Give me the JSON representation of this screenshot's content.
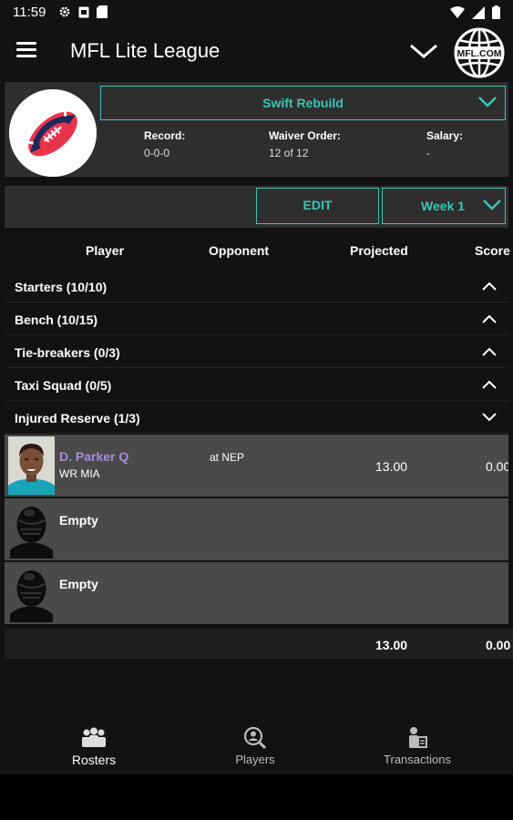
{
  "status_bar": {
    "time": "11:59"
  },
  "app_bar": {
    "title": "MFL Lite League",
    "logo_text": "MFL.COM"
  },
  "team": {
    "name": "Swift Rebuild",
    "stats": [
      {
        "label": "Record:",
        "value": "0-0-0"
      },
      {
        "label": "Waiver Order:",
        "value": "12 of 12"
      },
      {
        "label": "Salary:",
        "value": "-"
      }
    ]
  },
  "controls": {
    "edit_label": "EDIT",
    "week_label": "Week 1"
  },
  "columns": {
    "player": "Player",
    "opponent": "Opponent",
    "projected": "Projected",
    "score": "Score"
  },
  "sections": [
    {
      "label": "Starters (10/10)",
      "expanded": false
    },
    {
      "label": "Bench (10/15)",
      "expanded": false
    },
    {
      "label": "Tie-breakers (0/3)",
      "expanded": false
    },
    {
      "label": "Taxi Squad (0/5)",
      "expanded": false
    },
    {
      "label": "Injured Reserve (1/3)",
      "expanded": true
    }
  ],
  "injured_reserve": [
    {
      "name": "D. Parker",
      "status": "Q",
      "position": "WR MIA",
      "opponent": "at NEP",
      "projected": "13.00",
      "score": "0.00"
    },
    {
      "name": "Empty"
    },
    {
      "name": "Empty"
    }
  ],
  "totals": {
    "projected": "13.00",
    "score": "0.00"
  },
  "bottom_nav": [
    {
      "label": "Rosters",
      "icon": "people-icon",
      "active": true
    },
    {
      "label": "Players",
      "icon": "player-search-icon",
      "active": false
    },
    {
      "label": "Transactions",
      "icon": "transactions-icon",
      "active": false
    }
  ],
  "colors": {
    "accent": "#39c6b6",
    "player_name": "#a78bde",
    "card_bg": "#2e2e2e",
    "row_bg": "#4a4a4a"
  }
}
